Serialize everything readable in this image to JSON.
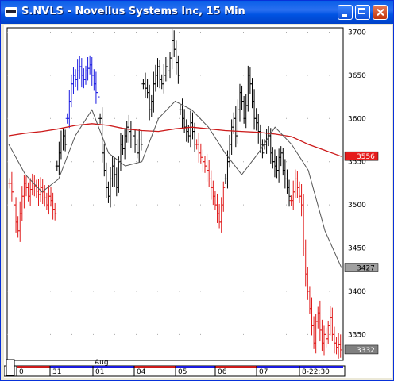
{
  "window": {
    "title": "S.NVLS - Novellus Systems Inc, 15 Min",
    "icon": "chart-app-icon",
    "controls": [
      "minimize",
      "maximize",
      "close"
    ],
    "colors": {
      "titlebar": "#0054e3",
      "close": "#c2350c"
    }
  },
  "chart_data": {
    "type": "bar",
    "subtype": "ohlc-price-bars",
    "title": "S.NVLS - Novellus Systems Inc, 15 Min",
    "x_labels": [
      "0",
      "31",
      "01",
      "04",
      "05",
      "06",
      "07",
      "8-22:30"
    ],
    "month_label": "Aug",
    "y_ticks": [
      3700,
      3650,
      3600,
      3550,
      3500,
      3450,
      3400,
      3350
    ],
    "ylim": [
      3320,
      3705
    ],
    "grid": "dotted",
    "last_tags": [
      {
        "label": "3556",
        "value": 3556,
        "color": "#e51c1c",
        "text_color": "#ffffff"
      },
      {
        "label": "3427",
        "value": 3427,
        "color": "#a0a0a0",
        "text_color": "#000000"
      },
      {
        "label": "3332",
        "value": 3332,
        "color": "#808080",
        "text_color": "#ffffff"
      }
    ],
    "colors": {
      "up": "#1a1ae0",
      "down": "#e01a1a",
      "neutral": "#000000",
      "ma_long": "#cc1a1a",
      "ma_short": "#555555"
    },
    "series": [
      {
        "kind": "price",
        "segments": [
          {
            "color": "down",
            "closes": [
              3525,
              3515,
              3500,
              3480,
              3470,
              3490,
              3510,
              3525,
              3520,
              3510,
              3518,
              3525,
              3522,
              3516,
              3512,
              3520,
              3515,
              3508,
              3500,
              3510,
              3505,
              3495,
              3490
            ]
          },
          {
            "color": "neutral",
            "closes": [
              3545,
              3560,
              3575,
              3580,
              3570
            ]
          },
          {
            "color": "up",
            "closes": [
              3600,
              3620,
              3640,
              3650,
              3645,
              3655,
              3660,
              3650,
              3645,
              3655,
              3658,
              3662,
              3650,
              3640,
              3630,
              3625
            ]
          },
          {
            "color": "neutral",
            "closes": [
              3600,
              3560,
              3540,
              3520,
              3510,
              3530,
              3545,
              3535,
              3520,
              3550,
              3570,
              3565,
              3580,
              3590,
              3585,
              3575,
              3580,
              3570,
              3560,
              3575,
              3570
            ]
          },
          {
            "color": "neutral",
            "closes": [
              3640,
              3635,
              3630,
              3610,
              3620,
              3640,
              3650,
              3660,
              3645,
              3640,
              3650,
              3660,
              3655,
              3670,
              3690,
              3680,
              3665,
              3650
            ]
          },
          {
            "color": "neutral",
            "closes": [
              3610,
              3600,
              3590,
              3585,
              3580,
              3595,
              3585,
              3575
            ]
          },
          {
            "color": "down",
            "closes": [
              3570,
              3560,
              3555,
              3550,
              3545,
              3540,
              3530,
              3520,
              3510,
              3500,
              3490,
              3480,
              3500,
              3520
            ]
          },
          {
            "color": "neutral",
            "closes": [
              3530,
              3550,
              3570,
              3590,
              3600,
              3580,
              3610,
              3630,
              3620,
              3600,
              3615,
              3650,
              3640,
              3620,
              3600,
              3595,
              3585,
              3570,
              3560
            ]
          },
          {
            "color": "neutral",
            "closes": [
              3570,
              3575,
              3580,
              3560,
              3550,
              3545,
              3540,
              3555,
              3560,
              3540,
              3530,
              3520,
              3510
            ]
          },
          {
            "color": "down",
            "closes": [
              3505,
              3515,
              3530,
              3520,
              3510,
              3500,
              3450,
              3420,
              3400,
              3380,
              3360,
              3340,
              3365,
              3375,
              3355,
              3340,
              3350,
              3345,
              3360,
              3370,
              3350,
              3340,
              3335,
              3338,
              3332
            ]
          }
        ]
      }
    ],
    "moving_averages": [
      {
        "name": "",
        "color": "ma_long",
        "values": [
          3580,
          3583,
          3585,
          3588,
          3592,
          3594,
          3592,
          3588,
          3586,
          3585,
          3588,
          3590,
          3588,
          3586,
          3585,
          3584,
          3582,
          3579,
          3570,
          3563,
          3556
        ]
      },
      {
        "name": "",
        "color": "ma_short",
        "values": [
          3570,
          3535,
          3515,
          3530,
          3580,
          3610,
          3560,
          3545,
          3550,
          3600,
          3620,
          3610,
          3590,
          3560,
          3535,
          3560,
          3590,
          3570,
          3540,
          3470,
          3427
        ]
      }
    ]
  }
}
